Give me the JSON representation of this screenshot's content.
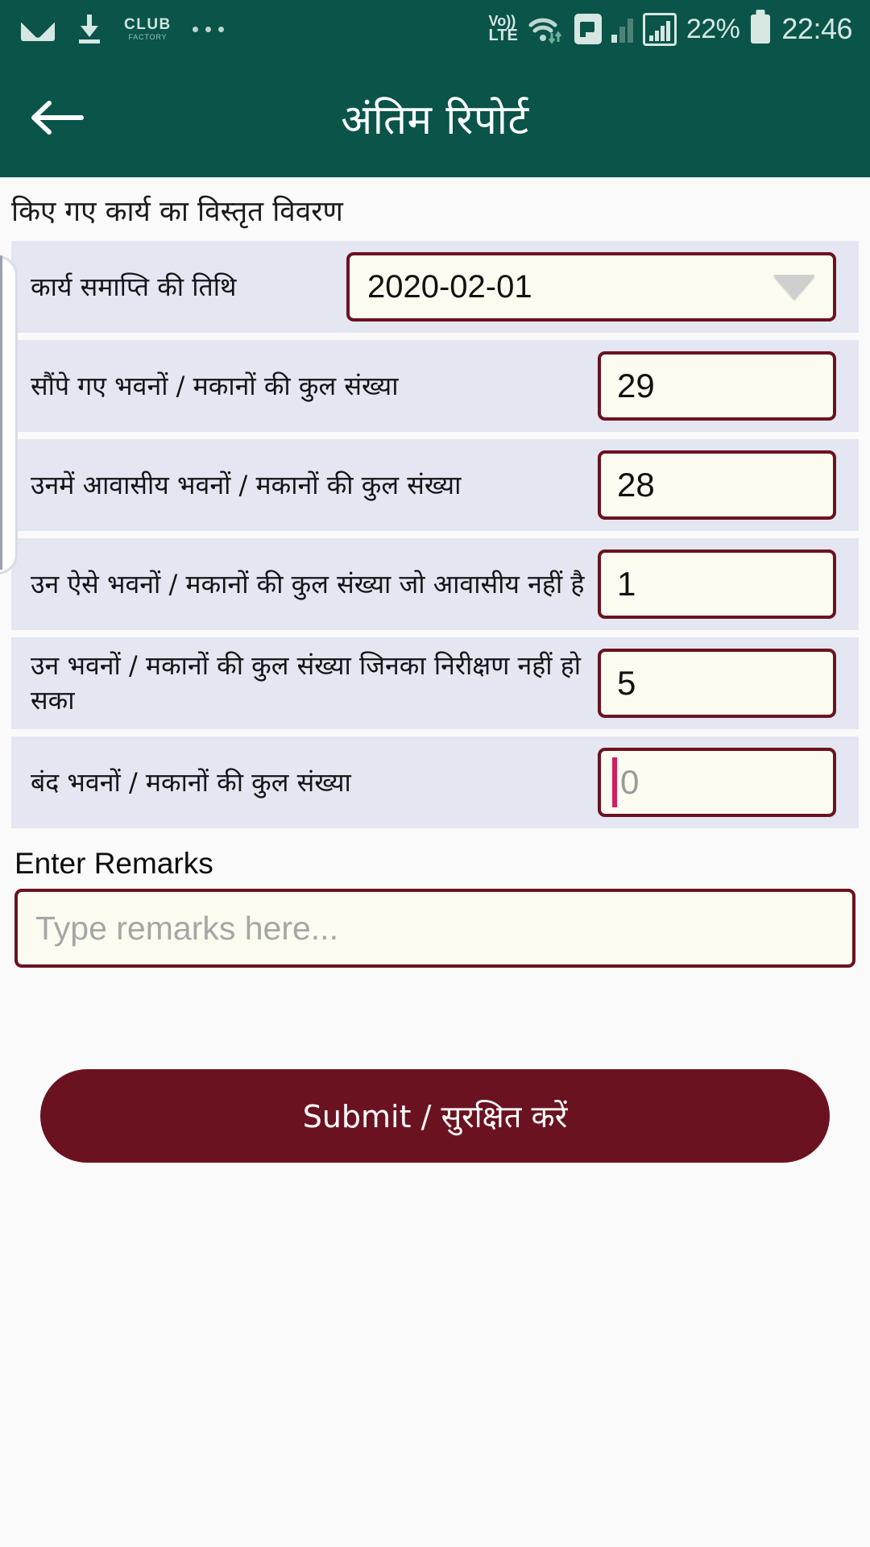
{
  "status_bar": {
    "left_icons": [
      {
        "name": "mail-icon",
        "label": "mail"
      },
      {
        "name": "download-icon",
        "label": "download"
      },
      {
        "name": "club-factory-logo",
        "main": "CLUB",
        "sub": "FACTORY"
      },
      {
        "name": "more-dots-icon",
        "label": "more"
      }
    ],
    "volte_top": "Vo))",
    "volte_bottom": "LTE",
    "battery_percent": "22%",
    "time": "22:46"
  },
  "app_bar": {
    "back_label": "back",
    "title": "अंतिम रिपोर्ट"
  },
  "section": {
    "heading": "किए गए कार्य का विस्तृत विवरण"
  },
  "form": {
    "rows": [
      {
        "label": "कार्य समाप्ति की तिथि",
        "type": "date",
        "value": "2020-02-01",
        "name": "work-completion-date"
      },
      {
        "label": "सौंपे गए भवनों / मकानों की कुल संख्या",
        "type": "number",
        "value": "29",
        "name": "total-assigned-buildings"
      },
      {
        "label": "उनमें आवासीय भवनों / मकानों की कुल संख्या",
        "type": "number",
        "value": "28",
        "name": "total-residential-buildings"
      },
      {
        "label": "उन ऐसे  भवनों / मकानों की कुल संख्या जो आवासीय नहीं है",
        "type": "number",
        "value": "1",
        "name": "total-non-residential-buildings"
      },
      {
        "label": "उन भवनों / मकानों की कुल संख्या जिनका निरीक्षण नहीं हो सका",
        "type": "number",
        "value": "5",
        "name": "total-uninspected-buildings"
      },
      {
        "label": "बंद भवनों / मकानों की कुल संख्या",
        "type": "number-focused",
        "value": "",
        "placeholder": "0",
        "name": "total-closed-buildings"
      }
    ]
  },
  "remarks": {
    "label": "Enter Remarks",
    "placeholder": "Type remarks here...",
    "value": ""
  },
  "submit": {
    "label": "Submit / सुरक्षित करें"
  },
  "colors": {
    "header_green": "#0a5449",
    "row_lavender": "#e4e6f2",
    "field_border_maroon": "#6b1220",
    "field_bg_cream": "#fbfbf0",
    "caret_pink": "#d81b60",
    "page_bg": "#fafafa"
  }
}
